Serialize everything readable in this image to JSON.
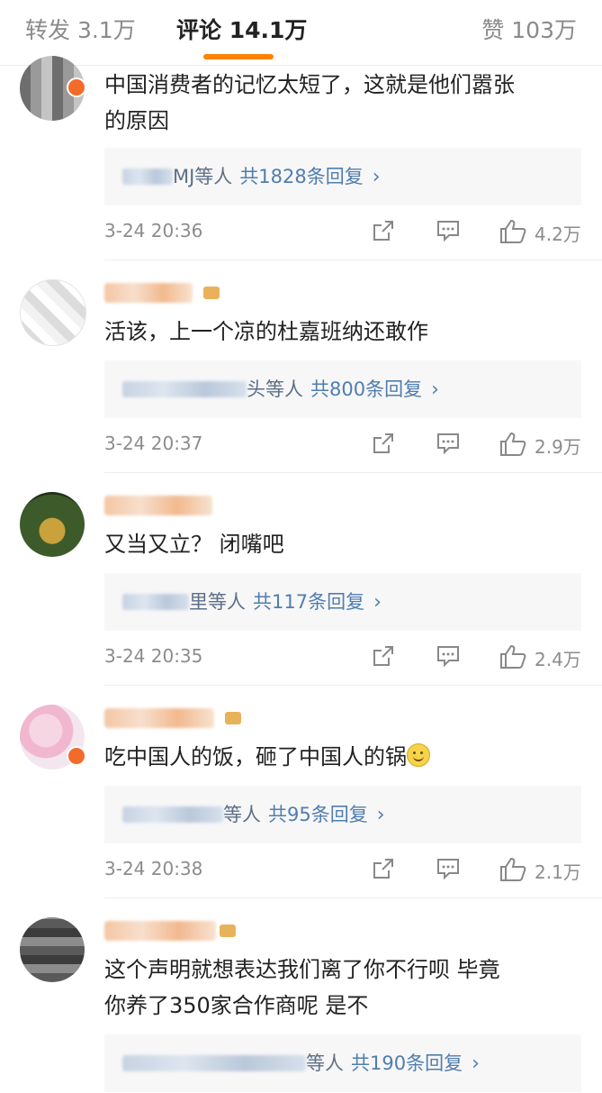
{
  "tabs": {
    "repost": "转发 3.1万",
    "comment": "评论 14.1万",
    "like": "赞 103万"
  },
  "colors": {
    "accent": "#ff8200",
    "link": "#507daf",
    "reply_bg": "#f7f7f7"
  },
  "comments": [
    {
      "line1": "中国消费者的记忆太短了，这就是他们嚣张",
      "line2": "的原因",
      "reply_name_tail": "MJ等人",
      "reply_count": "共1828条回复",
      "time": "3-24 20:36",
      "likes": "4.2万"
    },
    {
      "line1": "活该，上一个凉的杜嘉班纳还敢作",
      "line2": "",
      "reply_name_tail": "头等人",
      "reply_count": "共800条回复",
      "time": "3-24 20:37",
      "likes": "2.9万"
    },
    {
      "line1": "又当又立？ 闭嘴吧",
      "line2": "",
      "reply_name_tail": "里等人",
      "reply_count": "共117条回复",
      "time": "3-24 20:35",
      "likes": "2.4万"
    },
    {
      "line1": "吃中国人的饭，砸了中国人的锅",
      "line2": "",
      "reply_name_tail": "等人",
      "reply_count": "共95条回复",
      "time": "3-24 20:38",
      "likes": "2.1万"
    },
    {
      "line1": "这个声明就想表达我们离了你不行呗 毕竟",
      "line2": "你养了350家合作商呢 是不",
      "reply_name_tail": "等人",
      "reply_count": "共190条回复",
      "time": "",
      "likes": ""
    }
  ],
  "icons": {
    "share": "share-icon",
    "reply": "comment-icon",
    "like": "thumbs-up-icon",
    "chevron": "chevron-right-icon",
    "emoji": "smiley-emoji-icon"
  }
}
